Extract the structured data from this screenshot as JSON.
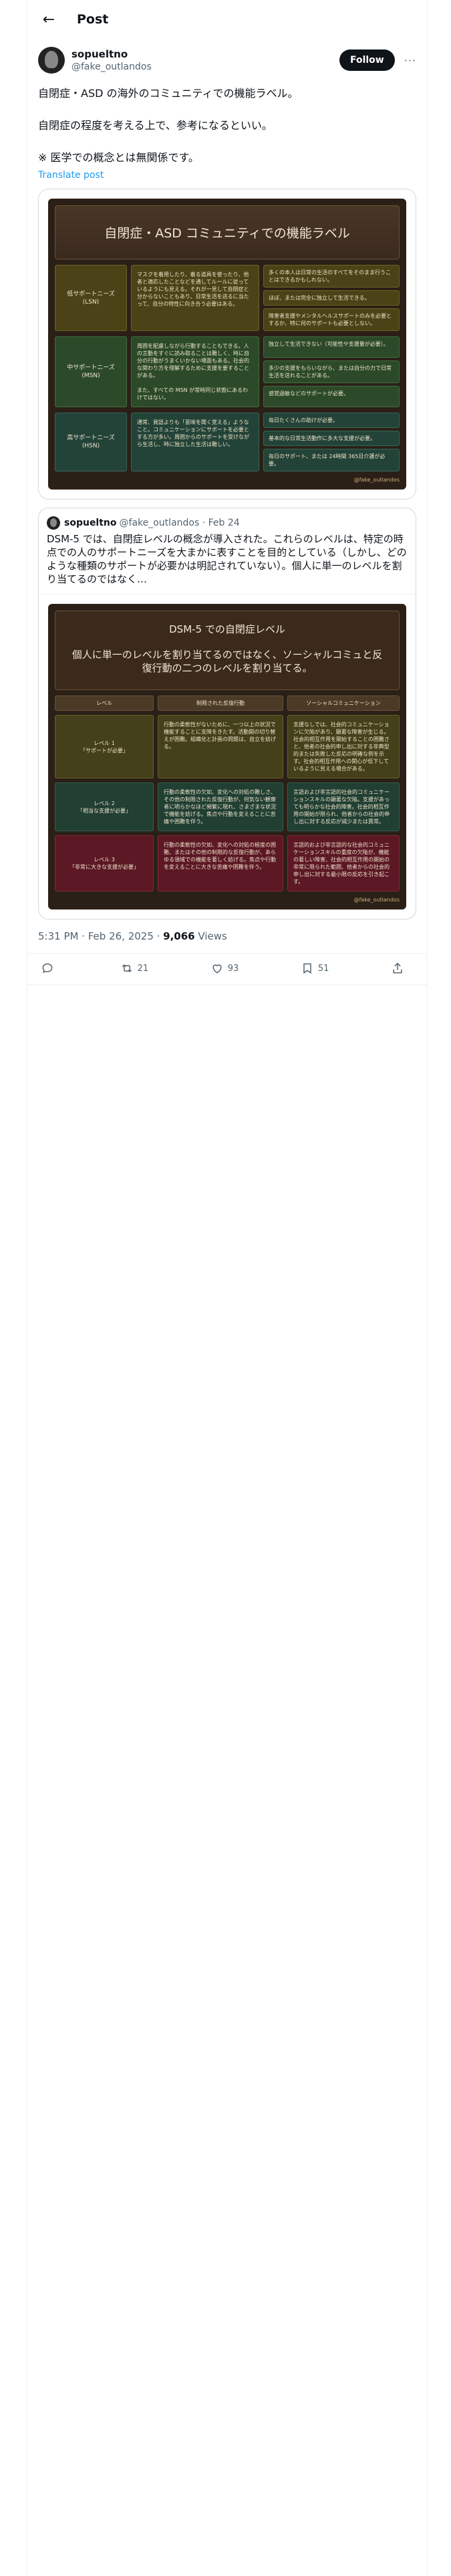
{
  "header": {
    "back_icon": "arrow-left-icon",
    "title": "Post"
  },
  "author": {
    "name": "sopueltno",
    "handle": "@fake_outlandos",
    "follow_label": "Follow",
    "more_label": "···"
  },
  "tweet": {
    "lines": [
      "自閉症・ASD の海外のコミュニティでの機能ラベル。",
      "自閉症の程度を考える上で、参考になるといい。",
      "※ 医学での概念とは無関係です。"
    ],
    "translate_label": "Translate post"
  },
  "image1": {
    "title": "自閉症・ASD コミュニティでの機能ラベル",
    "rows": [
      {
        "label": "低サポートニーズ (LSN)",
        "desc": "マスクを着用したり、着る道具を使ったり、他者と適応したことなどを通してルールに従っているようにも見える。それが一見して自閉症と分からないこともあり、日常生活を送るに当たって、自分の特性に向き合う必要はある。",
        "items": [
          "多くの本人は日常の生活のすべてをそのまま行うことはできるかもしれない。",
          "ほぼ、または完全に独立して生活できる。",
          "障害者支援やメンタルヘルスサポートのみを必要とするか、特に何のサポートも必要としない。"
        ]
      },
      {
        "label": "中サポートニーズ (MSN)",
        "desc": "周囲を配慮しながら行動することもできる。人の言動をすぐに読み取ることは難しく、時に自分の行動がうまくいかない場面もある。社会的な関わり方を理解するために支援を要することがある。\n\nまた、すべての MSN が常時同じ状態にあるわけではない。",
        "items": [
          "独立して生活できない（可能性や支援量が必要）。",
          "多少の支援をもらいながら、または自分の力で日常生活を送れることがある。",
          "感覚過敏などのサポートが必要。"
        ]
      },
      {
        "label": "高サポートニーズ (HSN)",
        "desc": "通常、発語よりも「意味を聞く覚える」ようなこと。コミュニケーションにサポートを必要とする方が多い。周囲からのサポートを受けながら生活し、時に独立した生活は難しい。",
        "items": [
          "毎日たくさんの助けが必要。",
          "基本的な日常生活動作に多大な支援が必要。",
          "毎日のサポート、または 24時間 365日介護が必要。"
        ]
      }
    ],
    "credit": "@fake_outlandos"
  },
  "quote": {
    "name": "sopueltno",
    "meta": "@fake_outlandos · Feb 24",
    "text": "DSM-5 では、自閉症レベルの概念が導入された。これらのレベルは、特定の時点での人のサポートニーズを大まかに表すことを目的としている（しかし、どのような種類のサポートが必要かは明記されていない）。個人に単一のレベルを割り当てるのではなく…",
    "image": {
      "title": "DSM-5 での自閉症レベル",
      "subtitle": "個人に単一のレベルを割り当てるのではなく、ソーシャルコミュと反復行動の二つのレベルを割り当てる。",
      "headers": [
        "レベル",
        "制限された反復行動",
        "ソーシャルコミュニケーション"
      ],
      "rows": [
        {
          "level": "レベル 1\n「サポートが必要」",
          "restrictive": "行動の柔軟性がないために、一つ以上の状況で機能することに支障をきたす。活動間の切り替えが困難。組織化と計画の問題は、自立を妨げる。",
          "social": "支援なしでは、社会的コミュニケーションに欠陥があり、顕著な障害が生じる。社会的相互作用を開始することの困難さと、他者の社会的申し出に対する非典型的または失敗した反応の明確な例を示す。社会的相互作用への関心が低下しているように見える場合がある。"
        },
        {
          "level": "レベル 2\n「相当な支援が必要」",
          "restrictive": "行動の柔軟性の欠如、変化への対処の難しさ、その他の制限された反復行動が、何気ない観察者に明らかなほど頻繁に現れ、さまざまな状況で機能を妨げる。焦点や行動を変えることに苦痛や困難を伴う。",
          "social": "言語および非言語的社会的コミュニケーションスキルの顕著な欠陥。支援があっても明らかな社会的障害。社会的相互作用の開始が限られ、他者からの社会的申し出に対する反応が減少または異常。"
        },
        {
          "level": "レベル 3\n「非常に大きな支援が必要」",
          "restrictive": "行動の柔軟性の欠如、変化への対処の極度の困難、またはその他の制限的な反復行動が、あらゆる領域での機能を著しく妨げる。焦点や行動を変えることに大きな苦痛や困難を伴う。",
          "social": "言語的および非言語的な社会的コミュニケーションスキルの重度の欠陥が、機能の著しい障害、社会的相互作用の開始の非常に限られた範囲、他者からの社会的申し出に対する最小限の反応を引き起こす。"
        }
      ],
      "credit": "@fake_outlandos"
    }
  },
  "meta": {
    "time": "5:31 PM · Feb 26, 2025 · ",
    "views_count": "9,066",
    "views_label": " Views"
  },
  "actions": {
    "reply": "",
    "repost": "21",
    "like": "93",
    "bookmark": "51",
    "share": ""
  }
}
